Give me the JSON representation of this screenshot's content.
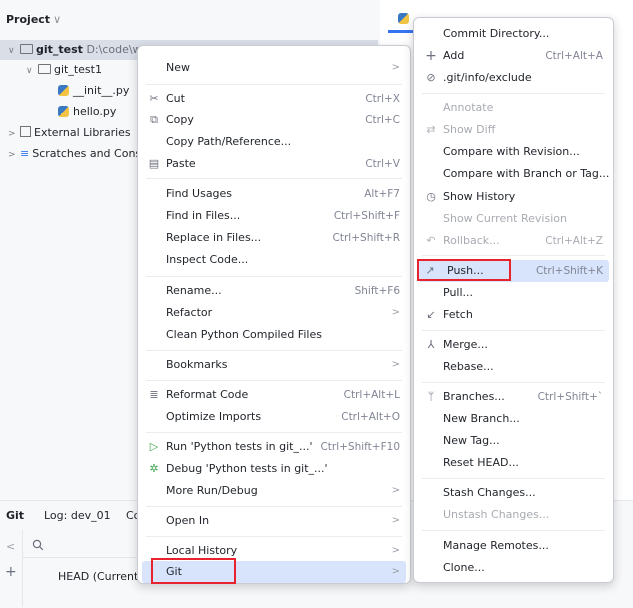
{
  "project_panel": {
    "title": "Project",
    "title_chevron": "∨",
    "tree": [
      {
        "label": "git_test",
        "path": "D:\\code\\w..."
      },
      {
        "label": "git_test1"
      },
      {
        "label": "__init__.py"
      },
      {
        "label": "hello.py"
      },
      {
        "label": "External Libraries"
      },
      {
        "label": "Scratches and Cons"
      }
    ]
  },
  "git_panel": {
    "title": "Git",
    "log_tab": "Log: dev_01",
    "next_tab_fragment": "Co",
    "head_label": "HEAD (Current"
  },
  "context_menu": {
    "items": [
      {
        "label": "New",
        "submenu": ">"
      },
      {
        "label": "Cut",
        "shortcut": "Ctrl+X",
        "icon": "cut-icon"
      },
      {
        "label": "Copy",
        "shortcut": "Ctrl+C",
        "icon": "copy-icon"
      },
      {
        "label": "Copy Path/Reference..."
      },
      {
        "label": "Paste",
        "shortcut": "Ctrl+V",
        "icon": "paste-icon"
      },
      {
        "label": "Find Usages",
        "shortcut": "Alt+F7"
      },
      {
        "label": "Find in Files...",
        "shortcut": "Ctrl+Shift+F"
      },
      {
        "label": "Replace in Files...",
        "shortcut": "Ctrl+Shift+R"
      },
      {
        "label": "Inspect Code..."
      },
      {
        "label": "Rename...",
        "shortcut": "Shift+F6"
      },
      {
        "label": "Refactor",
        "submenu": ">"
      },
      {
        "label": "Clean Python Compiled Files"
      },
      {
        "label": "Bookmarks",
        "submenu": ">"
      },
      {
        "label": "Reformat Code",
        "shortcut": "Ctrl+Alt+L",
        "icon": "reformat-icon"
      },
      {
        "label": "Optimize Imports",
        "shortcut": "Ctrl+Alt+O"
      },
      {
        "label": "Run 'Python tests in git_...'",
        "shortcut": "Ctrl+Shift+F10",
        "icon": "run-icon"
      },
      {
        "label": "Debug 'Python tests in git_...'",
        "icon": "debug-icon"
      },
      {
        "label": "More Run/Debug",
        "submenu": ">"
      },
      {
        "label": "Open In",
        "submenu": ">"
      },
      {
        "label": "Local History",
        "submenu": ">"
      },
      {
        "label": "Git",
        "submenu": ">"
      }
    ]
  },
  "git_submenu": {
    "items": [
      {
        "label": "Commit Directory..."
      },
      {
        "label": "Add",
        "shortcut": "Ctrl+Alt+A",
        "icon": "add-icon"
      },
      {
        "label": ".git/info/exclude",
        "icon": "ignore-icon"
      },
      {
        "label": "Annotate"
      },
      {
        "label": "Show Diff",
        "icon": "diff-icon"
      },
      {
        "label": "Compare with Revision..."
      },
      {
        "label": "Compare with Branch or Tag..."
      },
      {
        "label": "Show History",
        "icon": "history-icon"
      },
      {
        "label": "Show Current Revision"
      },
      {
        "label": "Rollback...",
        "shortcut": "Ctrl+Alt+Z",
        "icon": "rollback-icon"
      },
      {
        "label": "Push...",
        "shortcut": "Ctrl+Shift+K",
        "icon": "push-icon"
      },
      {
        "label": "Pull..."
      },
      {
        "label": "Fetch",
        "icon": "fetch-icon"
      },
      {
        "label": "Merge...",
        "icon": "merge-icon"
      },
      {
        "label": "Rebase..."
      },
      {
        "label": "Branches...",
        "shortcut": "Ctrl+Shift+`",
        "icon": "branch-icon"
      },
      {
        "label": "New Branch..."
      },
      {
        "label": "New Tag..."
      },
      {
        "label": "Reset HEAD..."
      },
      {
        "label": "Stash Changes..."
      },
      {
        "label": "Unstash Changes..."
      },
      {
        "label": "Manage Remotes..."
      },
      {
        "label": "Clone..."
      }
    ]
  },
  "colors": {
    "accent": "#3574f0",
    "highlight": "#d8e4fb",
    "annotation_red": "#e8232d"
  }
}
